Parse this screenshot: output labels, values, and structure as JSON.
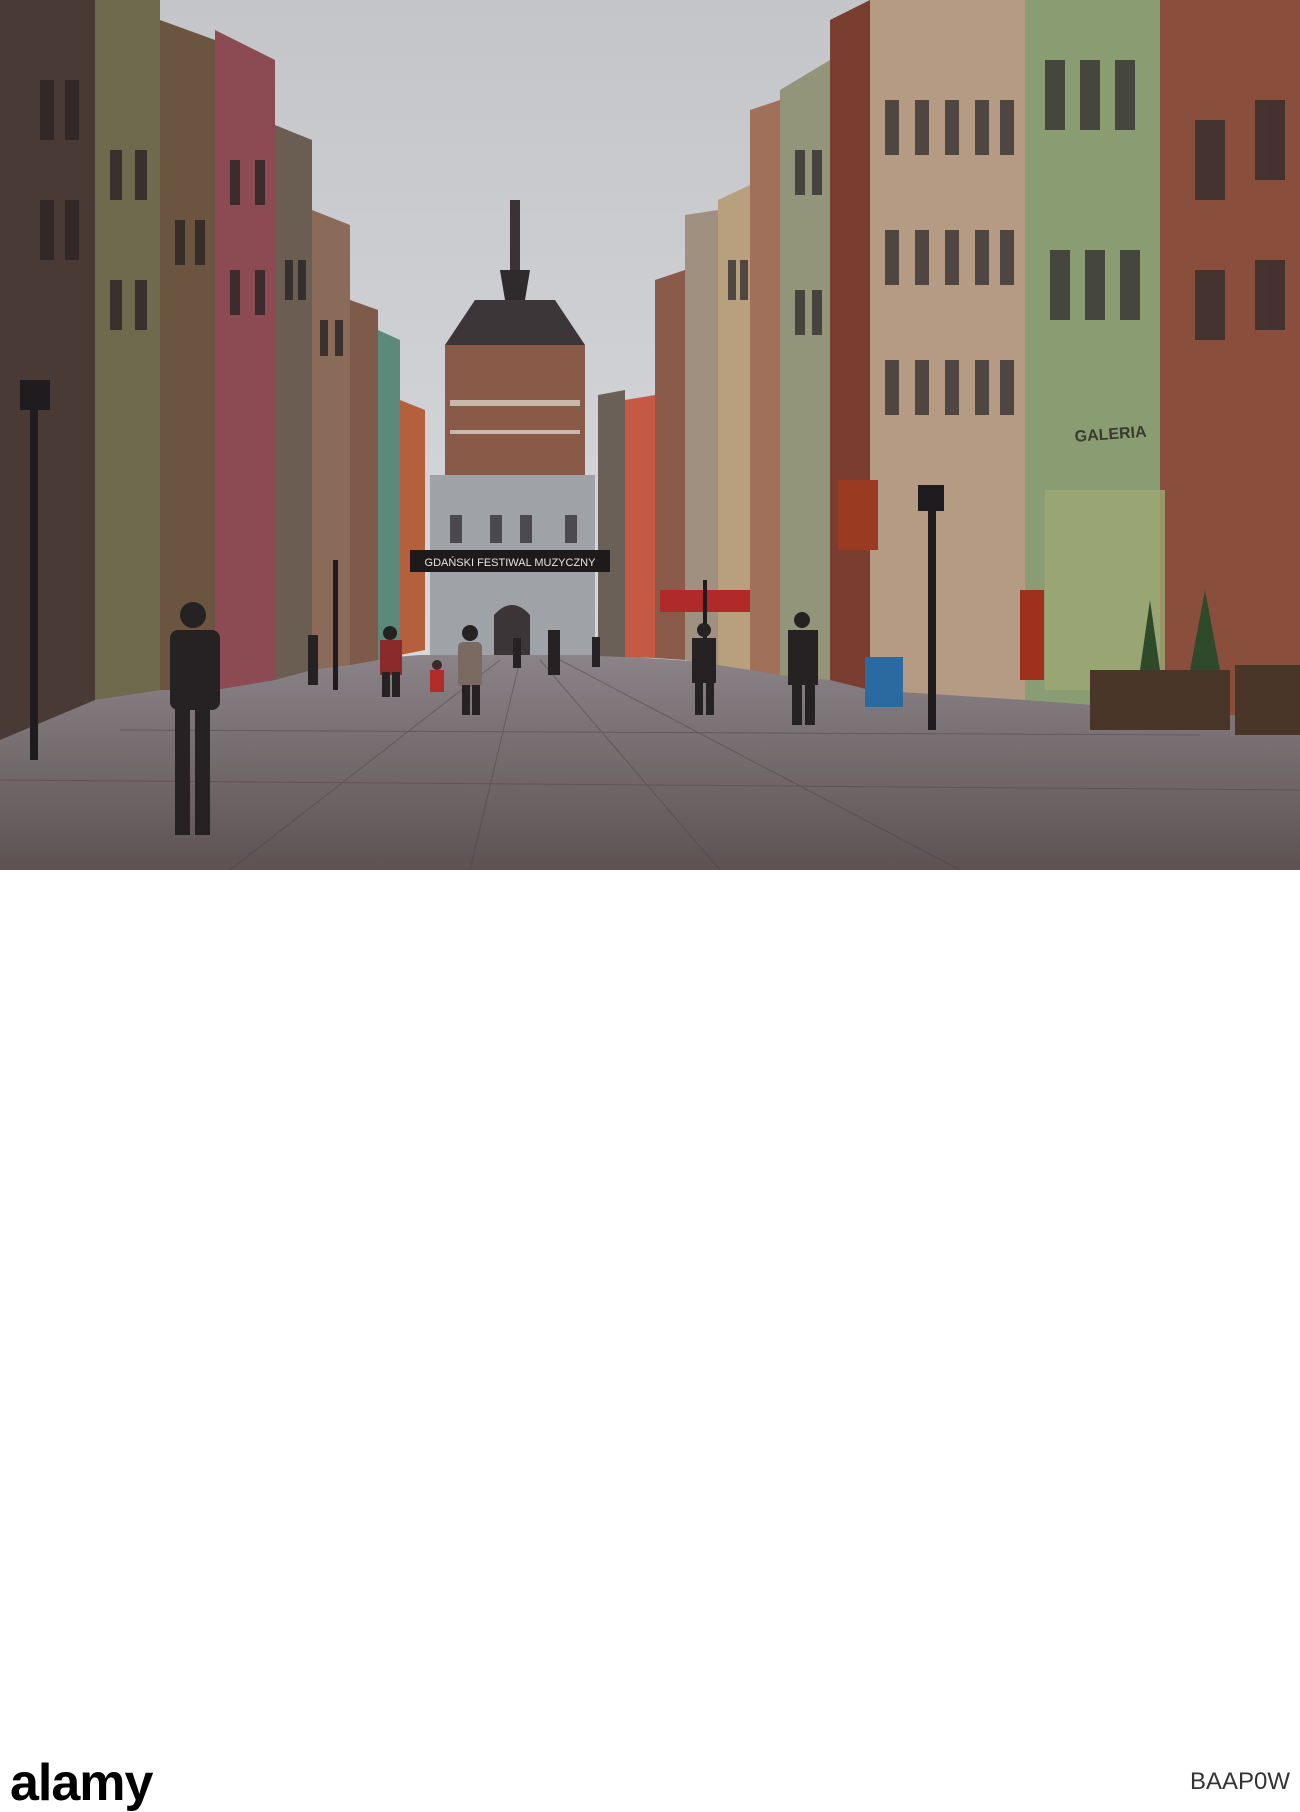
{
  "banner": {
    "text": "GDAŃSKI FESTIWAL MUZYCZNY"
  },
  "shop_signs": {
    "galeria": "GALERIA"
  },
  "footer": {
    "brand": "alamy",
    "image_id": "BAAP0W"
  },
  "colors": {
    "sky": "#cfd1d4",
    "pavement": "#6e6264",
    "footer_bg": "#ffffff",
    "brand_text": "#000000"
  }
}
